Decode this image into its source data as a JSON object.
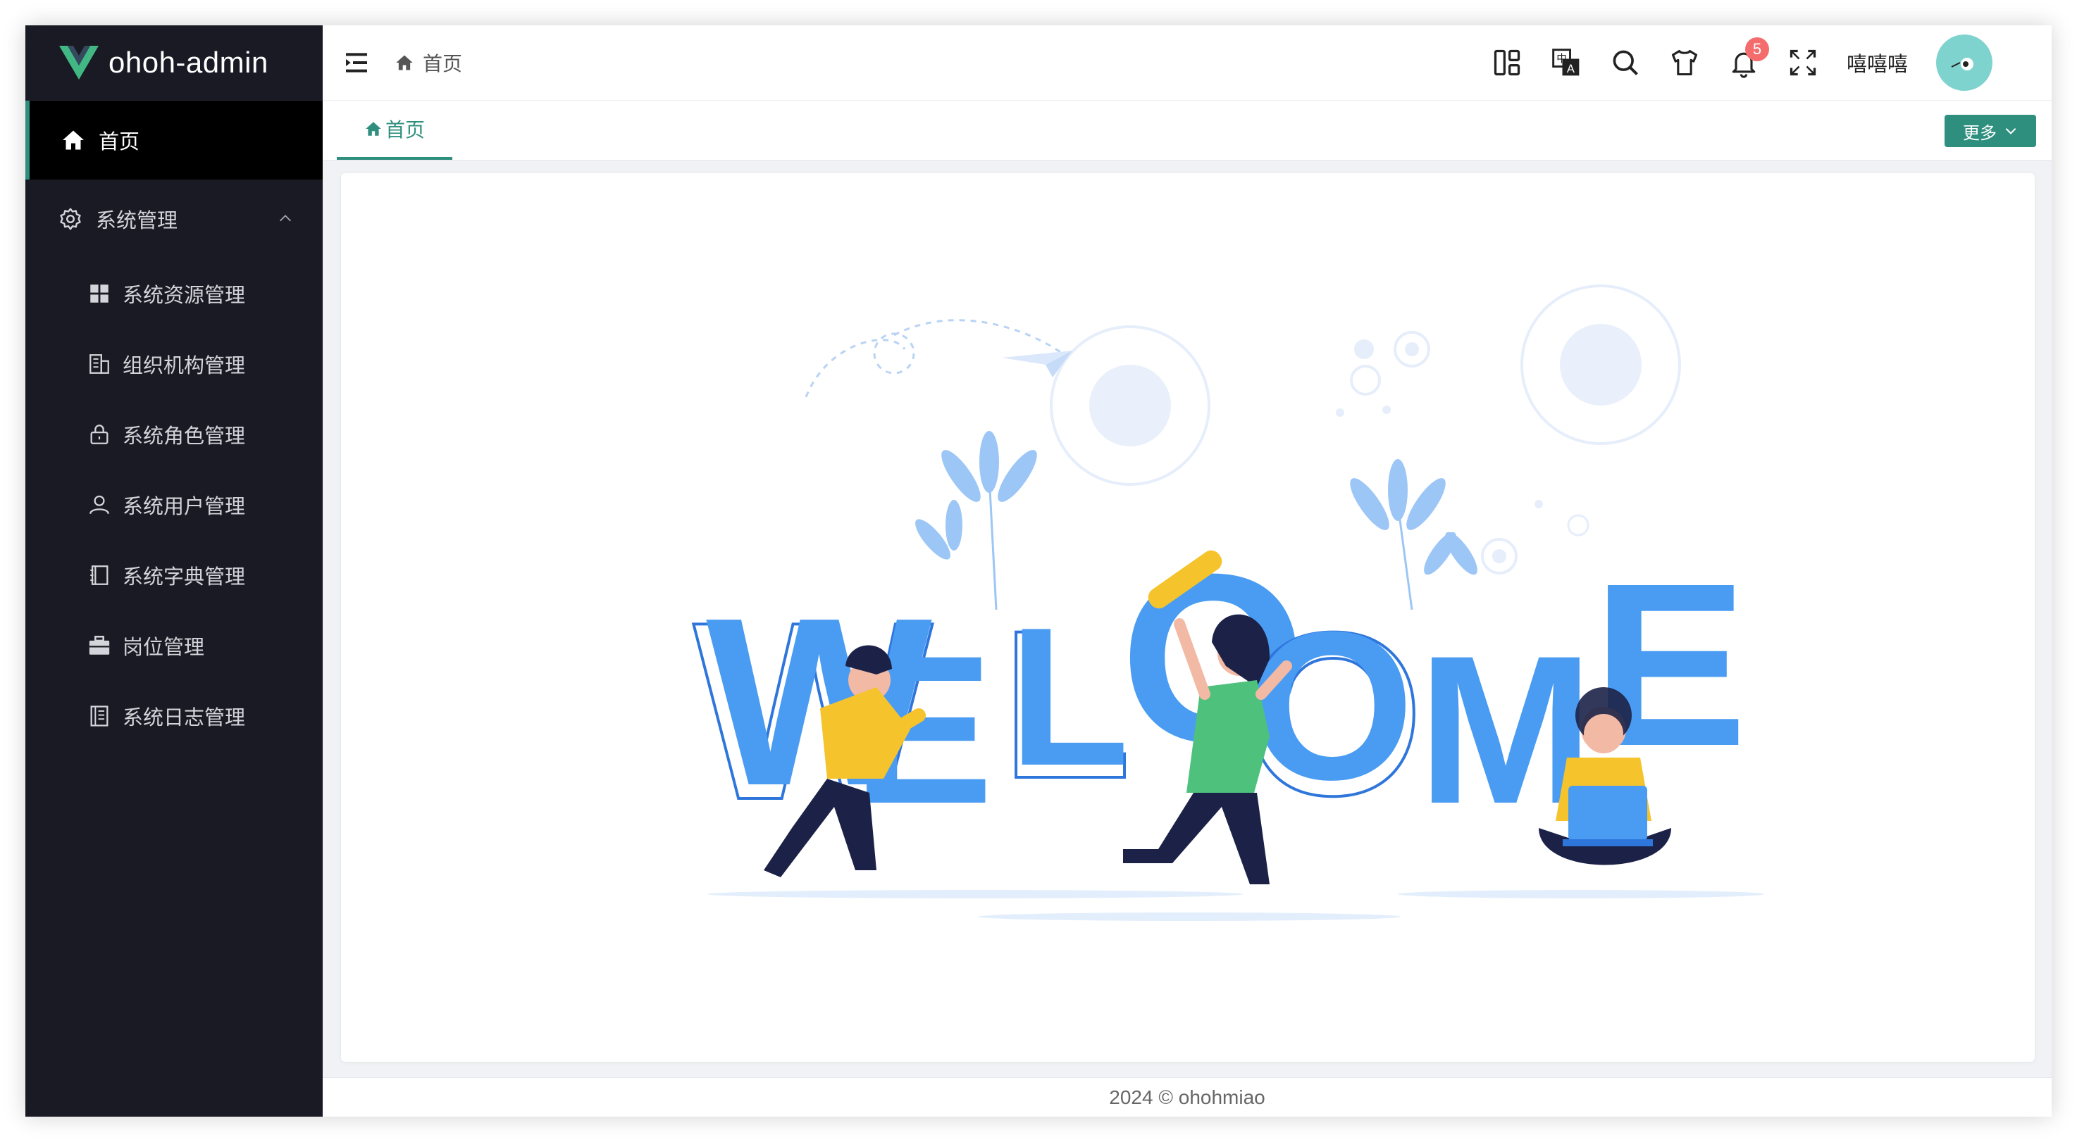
{
  "app": {
    "logo_text": "ohoh-admin"
  },
  "sidebar": {
    "home_label": "首页",
    "group_label": "系统管理",
    "items": [
      {
        "label": "系统资源管理",
        "icon": "grid-icon"
      },
      {
        "label": "组织机构管理",
        "icon": "building-icon"
      },
      {
        "label": "系统角色管理",
        "icon": "lock-icon"
      },
      {
        "label": "系统用户管理",
        "icon": "user-icon"
      },
      {
        "label": "系统字典管理",
        "icon": "book-icon"
      },
      {
        "label": "岗位管理",
        "icon": "briefcase-icon"
      },
      {
        "label": "系统日志管理",
        "icon": "log-icon"
      }
    ]
  },
  "header": {
    "breadcrumb": "首页",
    "notification_count": "5",
    "username": "嘻嘻嘻"
  },
  "tabs": {
    "active_tab": "首页",
    "more_label": "更多"
  },
  "footer": {
    "text": "2024 © ohohmiao"
  },
  "colors": {
    "accent": "#2f8f7f",
    "sidebar_bg": "#191a23",
    "welcome_blue": "#4a9cf2"
  }
}
